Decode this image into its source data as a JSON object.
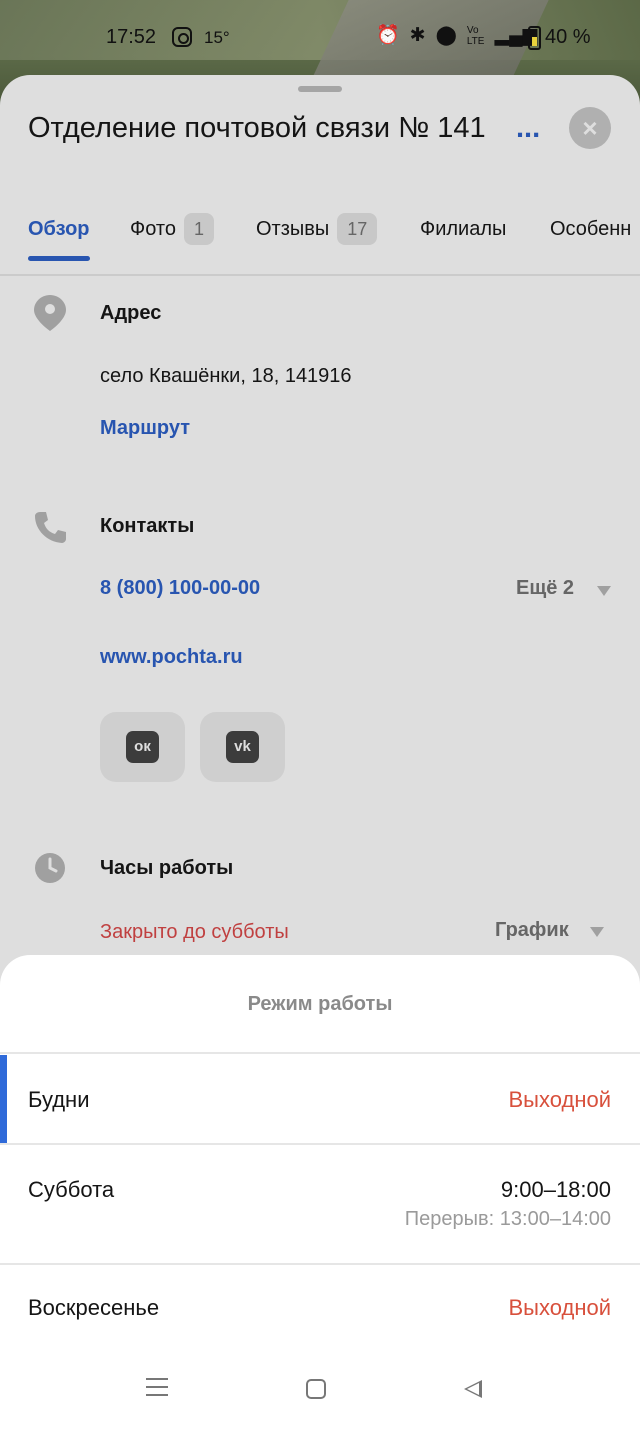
{
  "status_bar": {
    "time": "17:52",
    "temperature": "15°",
    "battery": "40 %",
    "icons": [
      "instagram-icon",
      "alarm-icon",
      "bluetooth-icon",
      "location-icon",
      "volte-icon",
      "signal-icon",
      "battery-icon"
    ]
  },
  "card": {
    "title": "Отделение почтовой связи № 141",
    "title_more": "...",
    "close_label": "×"
  },
  "tabs": [
    {
      "label": "Обзор",
      "active": true
    },
    {
      "label": "Фото",
      "count": "1"
    },
    {
      "label": "Отзывы",
      "count": "17"
    },
    {
      "label": "Филиалы"
    },
    {
      "label": "Особенн"
    }
  ],
  "address": {
    "heading": "Адрес",
    "value": "село Квашёнки, 18, 141916",
    "route_label": "Маршрут"
  },
  "contacts": {
    "heading": "Контакты",
    "phone": "8 (800) 100-00-00",
    "more_label": "Ещё 2",
    "website": "www.pochta.ru",
    "social": [
      {
        "name": "odnoklassniki",
        "glyph": "ок"
      },
      {
        "name": "vk",
        "glyph": "vk"
      }
    ]
  },
  "hours": {
    "heading": "Часы работы",
    "status": "Закрыто до субботы",
    "schedule_label": "График"
  },
  "sheet": {
    "title": "Режим работы",
    "rows": [
      {
        "day": "Будни",
        "value": "Выходной",
        "off": true
      },
      {
        "day": "Суббота",
        "value": "9:00–18:00",
        "break": "Перерыв: 13:00–14:00"
      },
      {
        "day": "Воскресенье",
        "value": "Выходной",
        "off": true
      }
    ]
  },
  "colors": {
    "accent": "#2855b0",
    "closed": "#d8503c",
    "selected_bar": "#2f6ad9"
  }
}
